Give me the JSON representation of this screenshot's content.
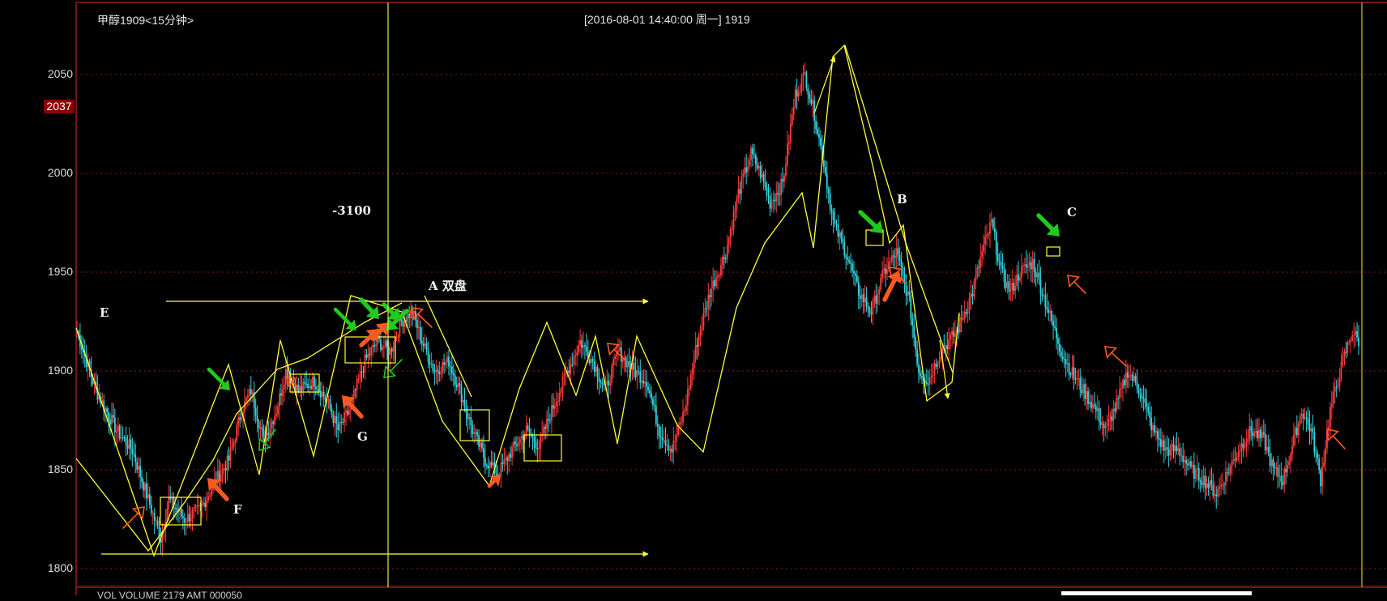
{
  "window": {
    "title": "甲醇1909<15分钟>"
  },
  "header": {
    "cursor_info": "[2016-08-01  14:40:00 周一]    1919"
  },
  "price_axis": {
    "labels": [
      "2050",
      "2000",
      "1950",
      "1900",
      "1850",
      "1800"
    ],
    "current_price": "2037"
  },
  "annotations": {
    "e": "E",
    "f": "F",
    "g": "G",
    "a": "A  双盘",
    "b": "B",
    "c": "C",
    "minus": "-3100"
  },
  "footer": {
    "text": "VOL  VOLUME 2179 AMT 000050"
  },
  "colors": {
    "bull": "#ff3b3b",
    "bear": "#33d6e0",
    "annotation_line": "#ffff33",
    "grid": "#8b1a1a",
    "buy_arrow": "#ff5a1e",
    "sell_arrow": "#1ecb1e"
  },
  "chart_data": {
    "type": "candlestick",
    "title": "甲醇1909<15分钟>",
    "timeframe": "15分钟",
    "cursor_time": "2016-08-01 14:40:00",
    "cursor_value": 1919,
    "ylim": [
      1795,
      2065
    ],
    "y_ticks": [
      1800,
      1850,
      1900,
      1950,
      2000,
      2050
    ],
    "grid": true,
    "path": [
      [
        0,
        1920
      ],
      [
        12,
        1890
      ],
      [
        25,
        1870
      ],
      [
        35,
        1860
      ],
      [
        45,
        1835
      ],
      [
        53,
        1815
      ],
      [
        58,
        1835
      ],
      [
        68,
        1825
      ],
      [
        78,
        1830
      ],
      [
        88,
        1845
      ],
      [
        96,
        1855
      ],
      [
        104,
        1880
      ],
      [
        110,
        1890
      ],
      [
        118,
        1865
      ],
      [
        126,
        1880
      ],
      [
        132,
        1900
      ],
      [
        140,
        1890
      ],
      [
        150,
        1895
      ],
      [
        158,
        1885
      ],
      [
        165,
        1870
      ],
      [
        172,
        1880
      ],
      [
        182,
        1905
      ],
      [
        190,
        1915
      ],
      [
        198,
        1910
      ],
      [
        205,
        1925
      ],
      [
        212,
        1930
      ],
      [
        218,
        1915
      ],
      [
        226,
        1900
      ],
      [
        235,
        1905
      ],
      [
        242,
        1890
      ],
      [
        250,
        1870
      ],
      [
        258,
        1855
      ],
      [
        266,
        1848
      ],
      [
        275,
        1860
      ],
      [
        284,
        1870
      ],
      [
        292,
        1862
      ],
      [
        300,
        1880
      ],
      [
        310,
        1900
      ],
      [
        318,
        1915
      ],
      [
        326,
        1905
      ],
      [
        334,
        1890
      ],
      [
        342,
        1910
      ],
      [
        352,
        1900
      ],
      [
        360,
        1895
      ],
      [
        368,
        1870
      ],
      [
        376,
        1860
      ],
      [
        384,
        1880
      ],
      [
        392,
        1915
      ],
      [
        400,
        1940
      ],
      [
        410,
        1960
      ],
      [
        418,
        1990
      ],
      [
        426,
        2010
      ],
      [
        432,
        2000
      ],
      [
        438,
        1985
      ],
      [
        446,
        1995
      ],
      [
        454,
        2040
      ],
      [
        460,
        2050
      ],
      [
        466,
        2030
      ],
      [
        472,
        2005
      ],
      [
        478,
        1975
      ],
      [
        486,
        1960
      ],
      [
        494,
        1940
      ],
      [
        502,
        1930
      ],
      [
        510,
        1950
      ],
      [
        518,
        1960
      ],
      [
        526,
        1935
      ],
      [
        532,
        1900
      ],
      [
        538,
        1895
      ],
      [
        546,
        1910
      ],
      [
        556,
        1920
      ],
      [
        566,
        1940
      ],
      [
        572,
        1960
      ],
      [
        578,
        1975
      ],
      [
        584,
        1950
      ],
      [
        590,
        1940
      ],
      [
        596,
        1950
      ],
      [
        604,
        1955
      ],
      [
        610,
        1940
      ],
      [
        616,
        1925
      ],
      [
        622,
        1910
      ],
      [
        628,
        1900
      ],
      [
        636,
        1890
      ],
      [
        644,
        1880
      ],
      [
        650,
        1870
      ],
      [
        658,
        1885
      ],
      [
        664,
        1900
      ],
      [
        672,
        1890
      ],
      [
        680,
        1870
      ],
      [
        688,
        1860
      ],
      [
        696,
        1860
      ],
      [
        704,
        1850
      ],
      [
        712,
        1845
      ],
      [
        720,
        1838
      ],
      [
        728,
        1850
      ],
      [
        734,
        1860
      ],
      [
        742,
        1870
      ],
      [
        750,
        1865
      ],
      [
        756,
        1850
      ],
      [
        762,
        1845
      ],
      [
        768,
        1862
      ],
      [
        774,
        1880
      ],
      [
        780,
        1870
      ],
      [
        786,
        1845
      ],
      [
        792,
        1880
      ],
      [
        800,
        1905
      ],
      [
        806,
        1920
      ],
      [
        810,
        1915
      ]
    ],
    "annotation_labels": [
      "E",
      "F",
      "G",
      "A  双盘",
      "B",
      "C",
      "-3100"
    ]
  }
}
